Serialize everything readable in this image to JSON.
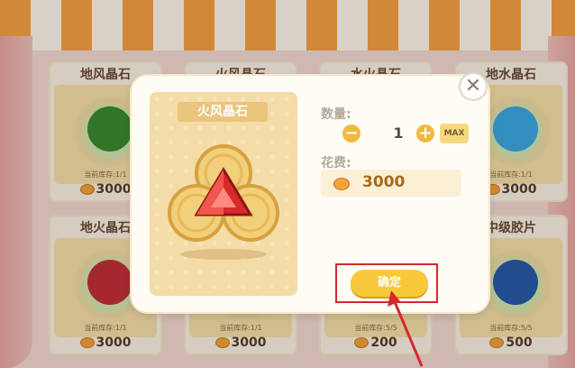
{
  "shop_items": [
    {
      "title": "地风晶石",
      "stock": "当前库存:1/1",
      "price": "3000",
      "color": "#3a8a2e"
    },
    {
      "title": "火风晶石",
      "stock": "",
      "price": "",
      "color": "#d43a2a"
    },
    {
      "title": "水火晶石",
      "stock": "",
      "price": "",
      "color": "#3f7fd8"
    },
    {
      "title": "地水晶石",
      "stock": "当前库存:1/1",
      "price": "3000",
      "color": "#3ba7e0"
    },
    {
      "title": "地火晶石",
      "stock": "当前库存:1/1",
      "price": "3000",
      "color": "#c2303a"
    },
    {
      "title": "",
      "stock": "当前库存:1/1",
      "price": "3000",
      "color": "#d43a2a"
    },
    {
      "title": "",
      "stock": "当前库存:5/5",
      "price": "200",
      "color": "#2f6ab0"
    },
    {
      "title": "中级胶片",
      "stock": "当前库存:5/5",
      "price": "500",
      "color": "#2a5aa8"
    }
  ],
  "dialog": {
    "item_name": "火风晶石",
    "qty_label": "数量:",
    "qty_value": "1",
    "minus": "−",
    "plus": "+",
    "max_label": "MAX",
    "cost_label": "花费:",
    "cost_value": "3000",
    "confirm_label": "确定",
    "close": "✕"
  },
  "colors": {
    "accent": "#f8c83b",
    "highlight": "#d7262f",
    "gem": "#d72b2b"
  }
}
